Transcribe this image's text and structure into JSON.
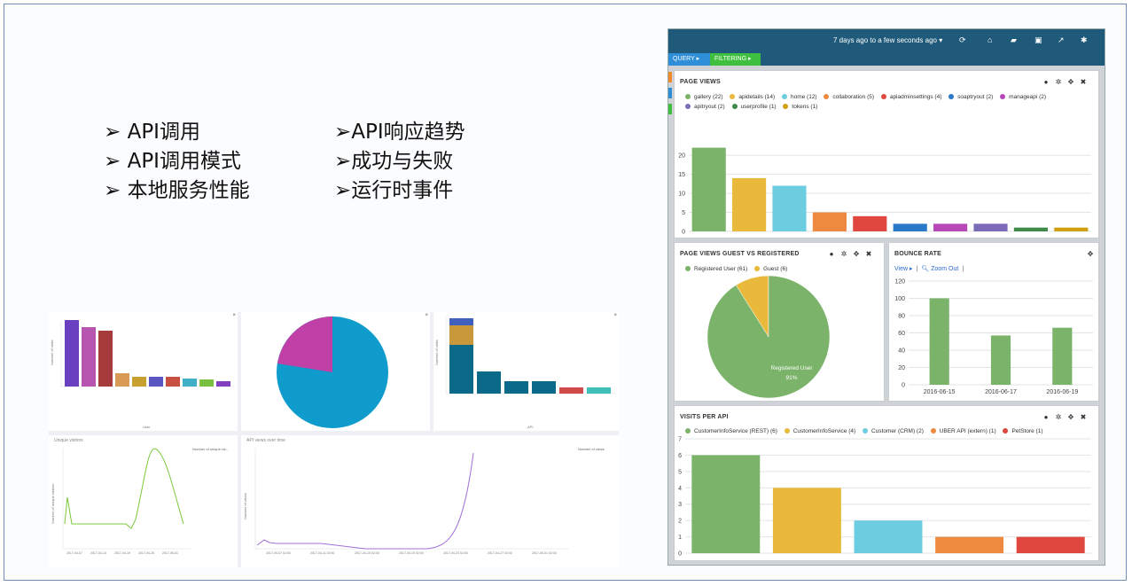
{
  "bullets_left": [
    "➢ API调用",
    "➢ API调用模式",
    "➢ 本地服务性能"
  ],
  "bullets_right": [
    "➢API响应趋势",
    "➢成功与失败",
    "➢运行时事件"
  ],
  "collage": {
    "visitors_title": "Unique visitors",
    "visitors_legend": "Number of unique vis...",
    "views_title": "API views over time",
    "views_legend": "Number of views",
    "ylabel_visits": "Number of visits",
    "xlabel_user": "User",
    "xlabel_api": "API",
    "ylabel_unique": "Number of unique visitors",
    "ylabel_views": "Number of views",
    "visitor_ticks": [
      "2017-04-07",
      "2017-04-13",
      "2017-04-19",
      "2017-04-25",
      "2017-05-01"
    ],
    "views_ticks": [
      "2017-04-07 02:00",
      "2017-04-11 02:00",
      "2017-04-15 02:00",
      "2017-04-19 02:00",
      "2017-04-23 02:00",
      "2017-04-27 02:00",
      "2017-05-01 02:00"
    ]
  },
  "dashboard": {
    "range_label": "7 days ago to a few seconds ago ▾",
    "toolbar_icons": [
      "refresh-icon",
      "home-icon",
      "folder-icon",
      "save-icon",
      "share-icon",
      "gear-icon"
    ],
    "tabs": [
      {
        "label": "QUERY ▸",
        "color": "#2e8fd8"
      },
      {
        "label": "FILTERING ▸",
        "color": "#3fbf3f"
      }
    ],
    "page_views": {
      "title": "PAGE VIEWS",
      "legend": [
        {
          "label": "gallery (22)",
          "color": "#7cb36b"
        },
        {
          "label": "apidetails (14)",
          "color": "#e8b93a"
        },
        {
          "label": "home (12)",
          "color": "#6dcde0"
        },
        {
          "label": "collaboration (5)",
          "color": "#ee8a3f"
        },
        {
          "label": "apiadminsettings (4)",
          "color": "#e0473f"
        },
        {
          "label": "soaptryout (2)",
          "color": "#2a78c8"
        },
        {
          "label": "manageapi (2)",
          "color": "#b848b8"
        },
        {
          "label": "apitryout (2)",
          "color": "#7a6ab8"
        },
        {
          "label": "userprofile (1)",
          "color": "#3f8a4a"
        },
        {
          "label": "tokens (1)",
          "color": "#d0a010"
        }
      ]
    },
    "guest_vs_registered": {
      "title": "PAGE VIEWS GUEST VS REGISTERED",
      "legend": [
        {
          "label": "Registered User (61)",
          "color": "#7cb36b"
        },
        {
          "label": "Guest (6)",
          "color": "#e8b93a"
        }
      ],
      "slice_label": "Registered User",
      "slice_percent": "91%"
    },
    "bounce_rate": {
      "title": "BOUNCE RATE",
      "view_link": "View ▸",
      "zoom_link": "Zoom Out",
      "sep": "|"
    },
    "visits_per_api": {
      "title": "VISITS PER API",
      "legend": [
        {
          "label": "CustomerInfoService (REST) (6)",
          "color": "#7cb36b"
        },
        {
          "label": "CustomerInfoService (4)",
          "color": "#e8b93a"
        },
        {
          "label": "Customer (CRM) (2)",
          "color": "#6dcde0"
        },
        {
          "label": "UBER API (extern) (1)",
          "color": "#ee8a3f"
        },
        {
          "label": "PetStore (1)",
          "color": "#e0473f"
        }
      ]
    }
  },
  "chart_data": [
    {
      "type": "bar",
      "title": "PAGE VIEWS",
      "categories": [
        "gallery",
        "apidetails",
        "home",
        "collaboration",
        "apiadminsettings",
        "soaptryout",
        "manageapi",
        "apitryout",
        "userprofile",
        "tokens"
      ],
      "values": [
        22,
        14,
        12,
        5,
        4,
        2,
        2,
        2,
        1,
        1
      ],
      "colors": [
        "#7cb36b",
        "#e8b93a",
        "#6dcde0",
        "#ee8a3f",
        "#e0473f",
        "#2a78c8",
        "#b848b8",
        "#7a6ab8",
        "#3f8a4a",
        "#d0a010"
      ],
      "yticks": [
        0,
        5,
        10,
        15,
        20
      ],
      "ylim": [
        0,
        24
      ]
    },
    {
      "type": "pie",
      "title": "PAGE VIEWS GUEST VS REGISTERED",
      "categories": [
        "Registered User",
        "Guest"
      ],
      "values": [
        61,
        6
      ],
      "colors": [
        "#7cb36b",
        "#e8b93a"
      ]
    },
    {
      "type": "bar",
      "title": "BOUNCE RATE",
      "categories": [
        "2016-06-15",
        "2016-06-17",
        "2016-06-19"
      ],
      "values": [
        100,
        57,
        66
      ],
      "colors": [
        "#7cb36b",
        "#7cb36b",
        "#7cb36b"
      ],
      "yticks": [
        0,
        20,
        40,
        60,
        80,
        100,
        120
      ],
      "ylim": [
        0,
        120
      ]
    },
    {
      "type": "bar",
      "title": "VISITS PER API",
      "categories": [
        "CustomerInfoService (REST)",
        "CustomerInfoService",
        "Customer (CRM)",
        "UBER API (extern)",
        "PetStore"
      ],
      "values": [
        6,
        4,
        2,
        1,
        1
      ],
      "colors": [
        "#7cb36b",
        "#e8b93a",
        "#6dcde0",
        "#ee8a3f",
        "#e0473f"
      ],
      "yticks": [
        0,
        1,
        2,
        3,
        4,
        5,
        6,
        7
      ],
      "ylim": [
        0,
        7
      ]
    }
  ]
}
